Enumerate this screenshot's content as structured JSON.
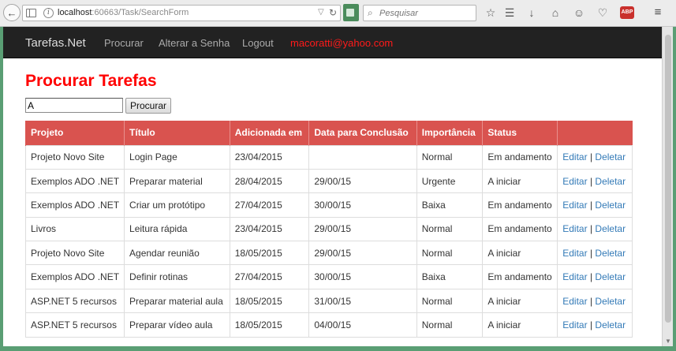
{
  "browser": {
    "url_host": "localhost",
    "url_rest": ":60663/Task/SearchForm",
    "search_placeholder": "Pesquisar",
    "abp_label": "ABP"
  },
  "navbar": {
    "brand": "Tarefas.Net",
    "items": [
      "Procurar",
      "Alterar a Senha",
      "Logout"
    ],
    "user": "macoratti@yahoo.com"
  },
  "page": {
    "title": "Procurar Tarefas",
    "search_value": "A",
    "search_button": "Procurar"
  },
  "table": {
    "headers": [
      "Projeto",
      "Título",
      "Adicionada em",
      "Data para Conclusão",
      "Importância",
      "Status",
      ""
    ],
    "edit_label": "Editar",
    "separator": "|",
    "delete_label": "Deletar",
    "rows": [
      [
        "Projeto Novo Site",
        "Login Page",
        "23/04/2015",
        "",
        "Normal",
        "Em andamento"
      ],
      [
        "Exemplos ADO .NET",
        "Preparar material",
        "28/04/2015",
        "29/00/15",
        "Urgente",
        "A iniciar"
      ],
      [
        "Exemplos ADO .NET",
        "Criar um protótipo",
        "27/04/2015",
        "30/00/15",
        "Baixa",
        "Em andamento"
      ],
      [
        "Livros",
        "Leitura rápida",
        "23/04/2015",
        "29/00/15",
        "Normal",
        "Em andamento"
      ],
      [
        "Projeto Novo Site",
        "Agendar reunião",
        "18/05/2015",
        "29/00/15",
        "Normal",
        "A iniciar"
      ],
      [
        "Exemplos ADO .NET",
        "Definir rotinas",
        "27/04/2015",
        "30/00/15",
        "Baixa",
        "Em andamento"
      ],
      [
        "ASP.NET 5 recursos",
        "Preparar material aula",
        "18/05/2015",
        "31/00/15",
        "Normal",
        "A iniciar"
      ],
      [
        "ASP.NET 5 recursos",
        "Preparar vídeo aula",
        "18/05/2015",
        "04/00/15",
        "Normal",
        "A iniciar"
      ]
    ]
  },
  "colors": {
    "header_bg": "#d9534f",
    "title": "#ff0000",
    "link": "#337ab7",
    "navbar": "#222222"
  }
}
